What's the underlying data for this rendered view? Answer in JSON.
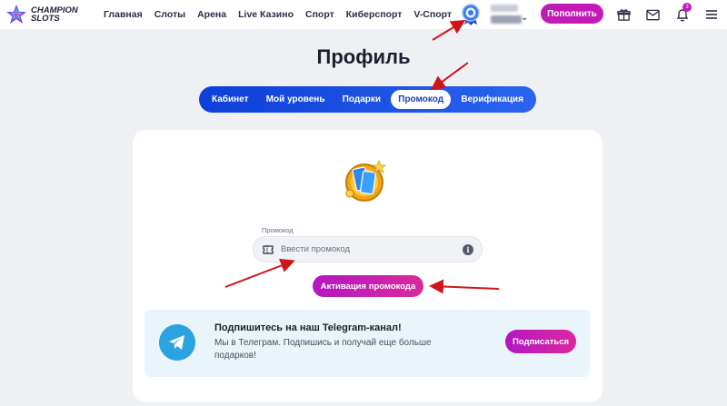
{
  "brand": {
    "line1": "CHAMPION",
    "line2": "SLOTS"
  },
  "nav": [
    {
      "label": "Главная"
    },
    {
      "label": "Слоты"
    },
    {
      "label": "Арена"
    },
    {
      "label": "Live Казино"
    },
    {
      "label": "Спорт"
    },
    {
      "label": "Киберспорт"
    },
    {
      "label": "V-Спорт"
    }
  ],
  "header": {
    "deposit_label": "Пополнить",
    "notification_count": "3",
    "level_badge_icon": "level-medal-icon"
  },
  "page": {
    "title": "Профиль"
  },
  "tabs": [
    {
      "label": "Кабинет",
      "active": false
    },
    {
      "label": "Мой уровень",
      "active": false
    },
    {
      "label": "Подарки",
      "active": false
    },
    {
      "label": "Промокод",
      "active": true
    },
    {
      "label": "Верификация",
      "active": false
    }
  ],
  "promo": {
    "label": "Промокод",
    "placeholder": "Ввести промокод",
    "value": "",
    "activate_label": "Активация промокода"
  },
  "telegram": {
    "title": "Подпишитесь на наш Telegram-канал!",
    "text": "Мы в Телеграм. Подпишись и получай еще больше подарков!",
    "button_label": "Подписаться"
  },
  "colors": {
    "accent": "#c21ab6",
    "tabs_bg": "#1a4fe0",
    "telegram": "#2ba3e0",
    "annotation_arrow": "#d0141c"
  }
}
